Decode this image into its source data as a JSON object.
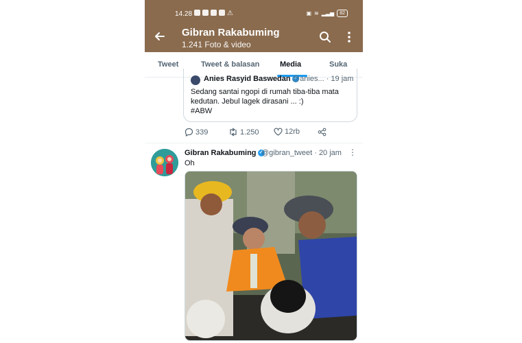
{
  "status": {
    "time": "14.28",
    "battery": "82"
  },
  "header": {
    "title": "Gibran Rakabuming",
    "subtitle": "1.241 Foto & video"
  },
  "tabs": [
    {
      "label": "Tweet"
    },
    {
      "label": "Tweet & balasan"
    },
    {
      "label": "Media"
    },
    {
      "label": "Suka"
    }
  ],
  "quoted_tweet": {
    "name": "Anies Rasyid Baswedan",
    "handle": "@anies...",
    "time": "· 19 jam",
    "text": "Sedang santai ngopi di rumah tiba-tiba mata kedutan. Jebul lagek dirasani ... :)",
    "hashtag": "#ABW"
  },
  "actions": {
    "replies": "339",
    "retweets": "1.250",
    "likes": "12rb"
  },
  "tweet": {
    "name": "Gibran Rakabuming",
    "handle": "@gibran_tweet",
    "time": "· 20 jam",
    "text": "Oh"
  },
  "colors": {
    "header_bg": "#8a6b4e",
    "accent": "#1d9bf0"
  },
  "icons": [
    "back-arrow-icon",
    "search-icon",
    "more-vertical-icon",
    "reply-icon",
    "retweet-icon",
    "like-icon",
    "share-icon",
    "verified-icon"
  ]
}
